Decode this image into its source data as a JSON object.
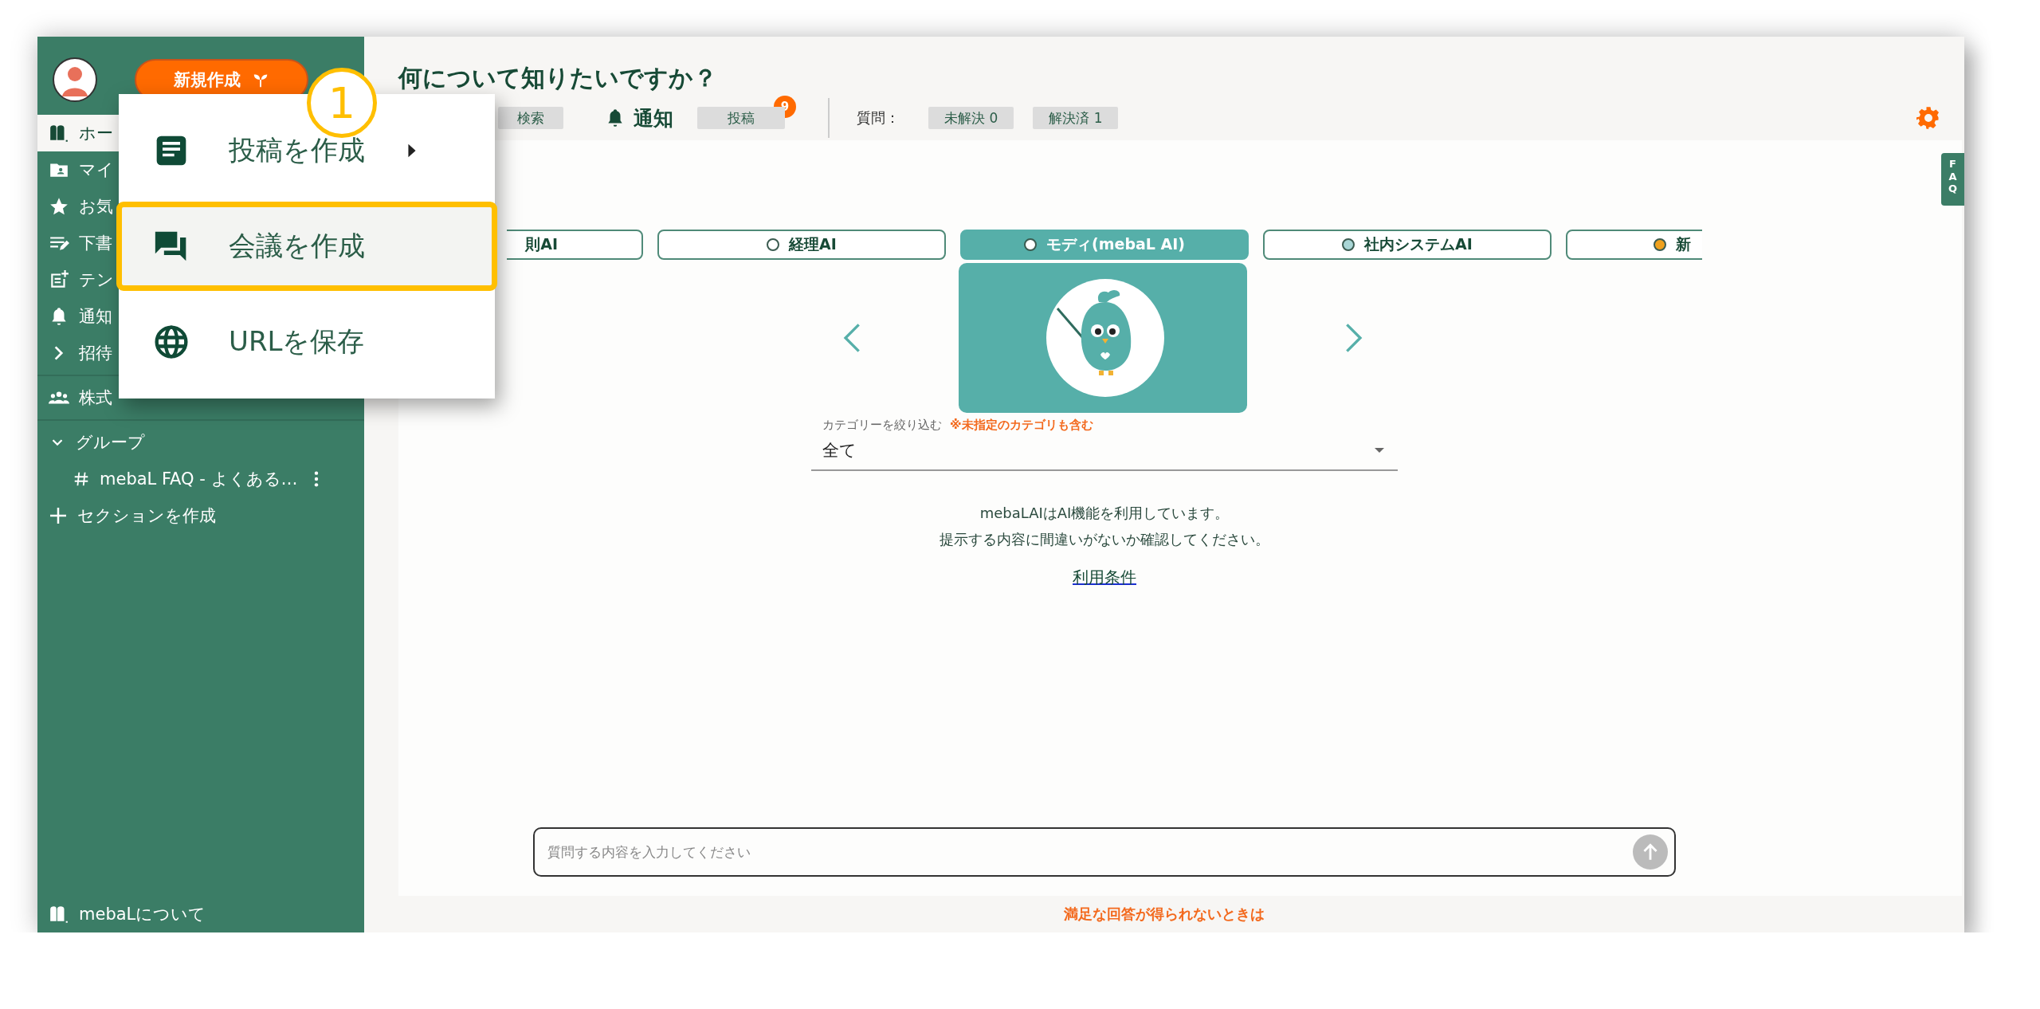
{
  "sidebar": {
    "new_button": "新規作成",
    "items": [
      {
        "kind": "home",
        "label": "ホー",
        "selected": true
      },
      {
        "kind": "folder",
        "label": "マイ",
        "selected": false
      },
      {
        "kind": "star",
        "label": "お気",
        "selected": false
      },
      {
        "kind": "draft",
        "label": "下書",
        "selected": false
      },
      {
        "kind": "template",
        "label": "テン",
        "selected": false
      },
      {
        "kind": "bell",
        "label": "通知",
        "selected": false
      },
      {
        "kind": "chevron",
        "label": "招待",
        "selected": false
      }
    ],
    "org": "株式",
    "group": {
      "label": "グループ",
      "expanded": true,
      "children": [
        {
          "label": "mebaL FAQ - よくある…"
        }
      ]
    },
    "create_section": "セクションを作成",
    "about": "mebaLについて"
  },
  "menu": {
    "step": "1",
    "items": [
      {
        "kind": "post",
        "label": "投稿を作成",
        "submenu": true,
        "highlighted": false
      },
      {
        "kind": "meeting",
        "label": "会議を作成",
        "submenu": false,
        "highlighted": true
      },
      {
        "kind": "url",
        "label": "URLを保存",
        "submenu": false,
        "highlighted": false
      }
    ]
  },
  "header": {
    "title": "何について知りたいですか？",
    "search_tab": "検索",
    "notifications": "通知",
    "post_chip": "投稿",
    "post_badge": "9",
    "question_label": "質問：",
    "question_chips": [
      "未解決 0",
      "解決済 1"
    ],
    "faq_tab": "FAQ"
  },
  "assistants": [
    {
      "label": "則AI",
      "selected": false
    },
    {
      "label": "経理AI",
      "color": "#ffffff",
      "selected": false
    },
    {
      "label": "モディ(mebaL AI)",
      "color": "#ffffff",
      "selected": true
    },
    {
      "label": "社内システムAI",
      "color": "#a9d6d6",
      "selected": false
    },
    {
      "label": "新",
      "color": "#f0a11e",
      "selected": false
    }
  ],
  "category": {
    "label": "カテゴリーを絞り込む",
    "note": "※未指定のカテゴリも含む",
    "value": "全て"
  },
  "notice": [
    "mebaLAIはAI機能を利用しています。",
    "提示する内容に間違いがないか確認してください。"
  ],
  "terms_link": "利用条件",
  "question_input": {
    "placeholder": "質問する内容を入力してください"
  },
  "footer": "満足な回答が得られないときは"
}
